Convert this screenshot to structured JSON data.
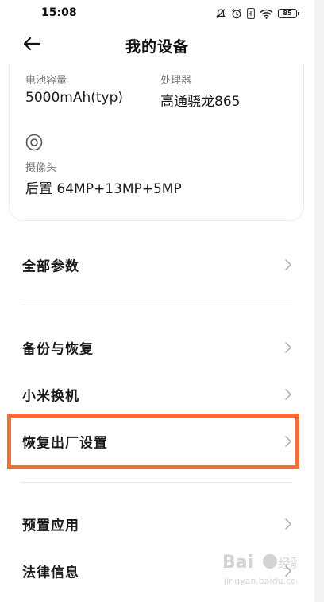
{
  "status_bar": {
    "time": "15:08",
    "battery": "85",
    "icons": [
      "notification-off-icon",
      "alarm-icon",
      "hd-icon",
      "wifi-icon",
      "battery-icon"
    ]
  },
  "header": {
    "title": "我的设备",
    "back_icon": "arrow-left-icon"
  },
  "specs": {
    "battery_label": "电池容量",
    "battery_value": "5000mAh(typ)",
    "processor_label": "处理器",
    "processor_value": "高通骁龙865",
    "camera_icon": "camera-lens-icon",
    "camera_label": "摄像头",
    "camera_value": "后置 64MP+13MP+5MP"
  },
  "menu": {
    "all_params": "全部参数",
    "backup_restore": "备份与恢复",
    "mi_mover": "小米换机",
    "factory_reset": "恢复出厂设置",
    "preinstalled_apps": "预置应用",
    "legal_info": "法律信息",
    "chevron_icon": "chevron-right-icon"
  },
  "colors": {
    "highlight": "#f36f3a",
    "background": "#ffffff",
    "label_gray": "#7a7a7a",
    "divider": "#e8e8e8"
  }
}
